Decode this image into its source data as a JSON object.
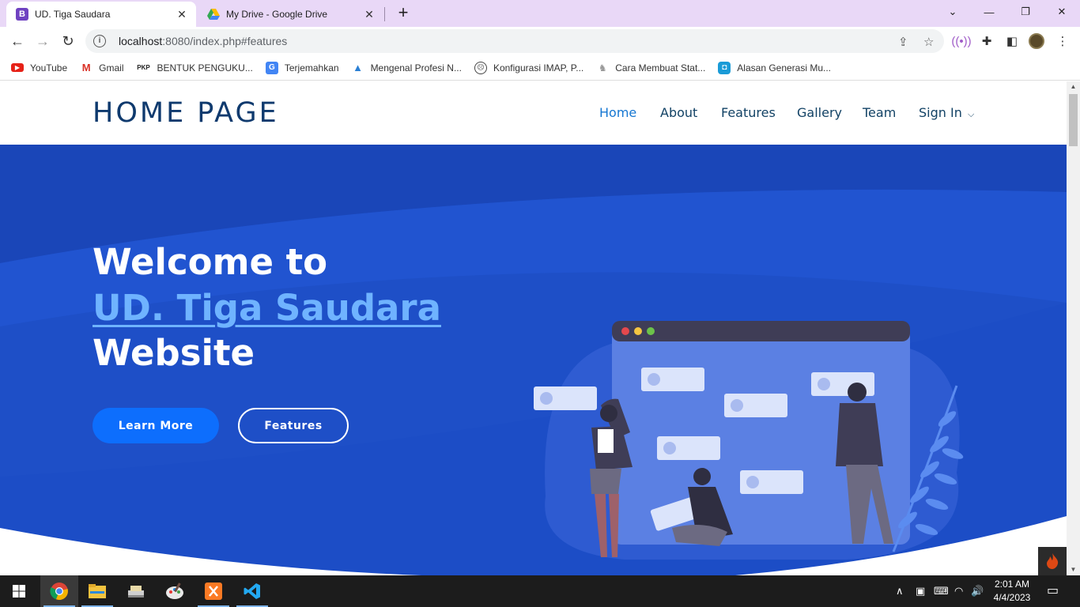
{
  "browser": {
    "tabs": [
      {
        "title": "UD. Tiga Saudara",
        "favicon": "bootstrap-icon",
        "active": true
      },
      {
        "title": "My Drive - Google Drive",
        "favicon": "google-drive-icon",
        "active": false
      }
    ],
    "url_host": "localhost",
    "url_rest": ":8080/index.php#features",
    "bookmarks": [
      {
        "label": "YouTube",
        "icon": "youtube-icon"
      },
      {
        "label": "Gmail",
        "icon": "gmail-icon"
      },
      {
        "label": "BENTUK PENGUKU...",
        "icon": "pkp-icon"
      },
      {
        "label": "Terjemahkan",
        "icon": "translate-icon"
      },
      {
        "label": "Mengenal Profesi N...",
        "icon": "arrow-logo-icon"
      },
      {
        "label": "Konfigurasi IMAP, P...",
        "icon": "face-icon"
      },
      {
        "label": "Cara Membuat Stat...",
        "icon": "figure-icon"
      },
      {
        "label": "Alasan Generasi Mu...",
        "icon": "square-logo-icon"
      }
    ]
  },
  "site": {
    "logo": "HOME PAGE",
    "nav": [
      "Home",
      "About",
      "Features",
      "Gallery",
      "Team",
      "Sign In"
    ],
    "hero": {
      "line1": "Welcome to",
      "line2": "UD. Tiga Saudara",
      "line3": "Website",
      "primary_button": "Learn More",
      "secondary_button": "Features"
    }
  },
  "taskbar": {
    "time": "2:01 AM",
    "date": "4/4/2023"
  },
  "colors": {
    "hero_bg": "#1e4fc7",
    "accent": "#6fb3ff",
    "primary_button": "#0d6efd",
    "nav_active": "#1677d2",
    "tabbar": "#e9d8f7"
  }
}
